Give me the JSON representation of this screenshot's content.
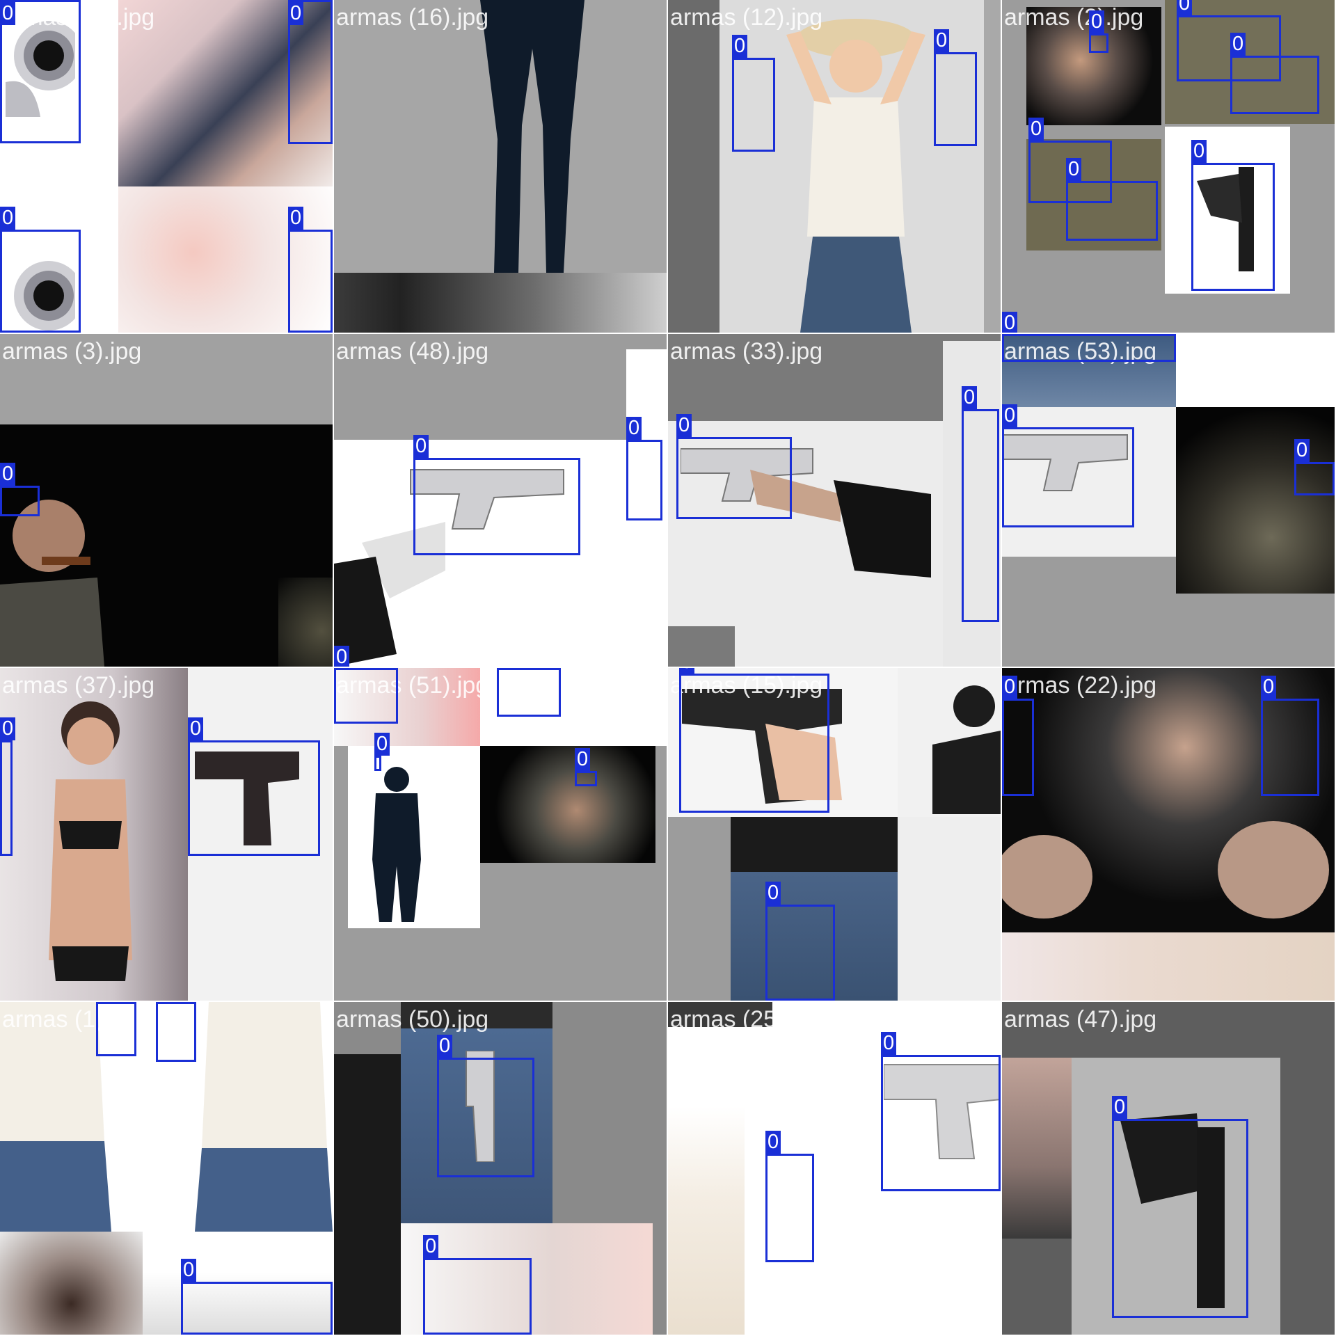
{
  "colors": {
    "box": "#1a2fd6",
    "pad": "#9c9c9c",
    "label_text": "#ffffff"
  },
  "tiles": [
    {
      "file": "armas (49).jpg",
      "labels": [
        "0",
        "0",
        "0",
        "0"
      ]
    },
    {
      "file": "armas (16).jpg",
      "labels": []
    },
    {
      "file": "armas (12).jpg",
      "labels": [
        "0",
        "0"
      ]
    },
    {
      "file": "armas (2).jpg",
      "labels": [
        "0",
        "0",
        "0",
        "0",
        "0",
        "0",
        "0"
      ]
    },
    {
      "file": "armas (3).jpg",
      "labels": [
        "0"
      ]
    },
    {
      "file": "armas (48).jpg",
      "labels": [
        "0",
        "0",
        "0"
      ]
    },
    {
      "file": "armas (33).jpg",
      "labels": [
        "0",
        "0"
      ]
    },
    {
      "file": "armas (53).jpg",
      "labels": [
        "0",
        "0",
        "0"
      ]
    },
    {
      "file": "armas (37).jpg",
      "labels": [
        "0",
        "0"
      ]
    },
    {
      "file": "armas (51).jpg",
      "labels": [
        "0",
        "0",
        "0",
        "0"
      ]
    },
    {
      "file": "armas (15).jpg",
      "labels": [
        "0",
        "0"
      ]
    },
    {
      "file": "armas (22).jpg",
      "labels": [
        "0",
        "0"
      ]
    },
    {
      "file": "armas (1).jpg",
      "labels": [
        "0",
        "0",
        "0"
      ]
    },
    {
      "file": "armas (50).jpg",
      "labels": [
        "0",
        "0"
      ]
    },
    {
      "file": "armas (25).jpg",
      "labels": [
        "0",
        "0"
      ]
    },
    {
      "file": "armas (47).jpg",
      "labels": [
        "0"
      ]
    }
  ]
}
